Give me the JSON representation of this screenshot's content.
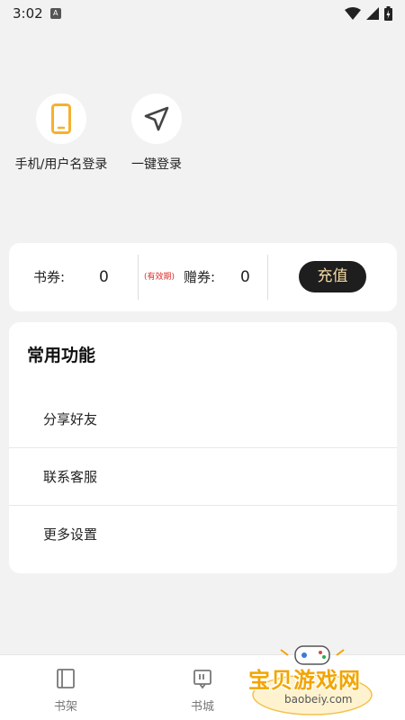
{
  "status_bar": {
    "time": "3:02",
    "notification_icon": "A"
  },
  "login": {
    "phone_label": "手机/用户名登录",
    "quick_label": "一键登录"
  },
  "voucher": {
    "book_coupon_label": "书券:",
    "book_coupon_value": "0",
    "validity_note": "(有效期)",
    "gift_coupon_label": "赠券:",
    "gift_coupon_value": "0",
    "recharge_label": "充值"
  },
  "functions": {
    "title": "常用功能",
    "items": [
      {
        "label": "分享好友"
      },
      {
        "label": "联系客服"
      },
      {
        "label": "更多设置"
      }
    ]
  },
  "bottom_nav": {
    "items": [
      {
        "label": "书架",
        "icon": "book-icon"
      },
      {
        "label": "书城",
        "icon": "store-icon"
      }
    ]
  },
  "watermark": {
    "title": "宝贝游戏网",
    "subtitle": "baobeiy.com"
  },
  "colors": {
    "phone_icon": "#f5b12e",
    "recharge_bg": "#1e1e1e",
    "recharge_text": "#f4d9a5",
    "validity_text": "#e02b2b",
    "watermark": "#f2a500"
  }
}
